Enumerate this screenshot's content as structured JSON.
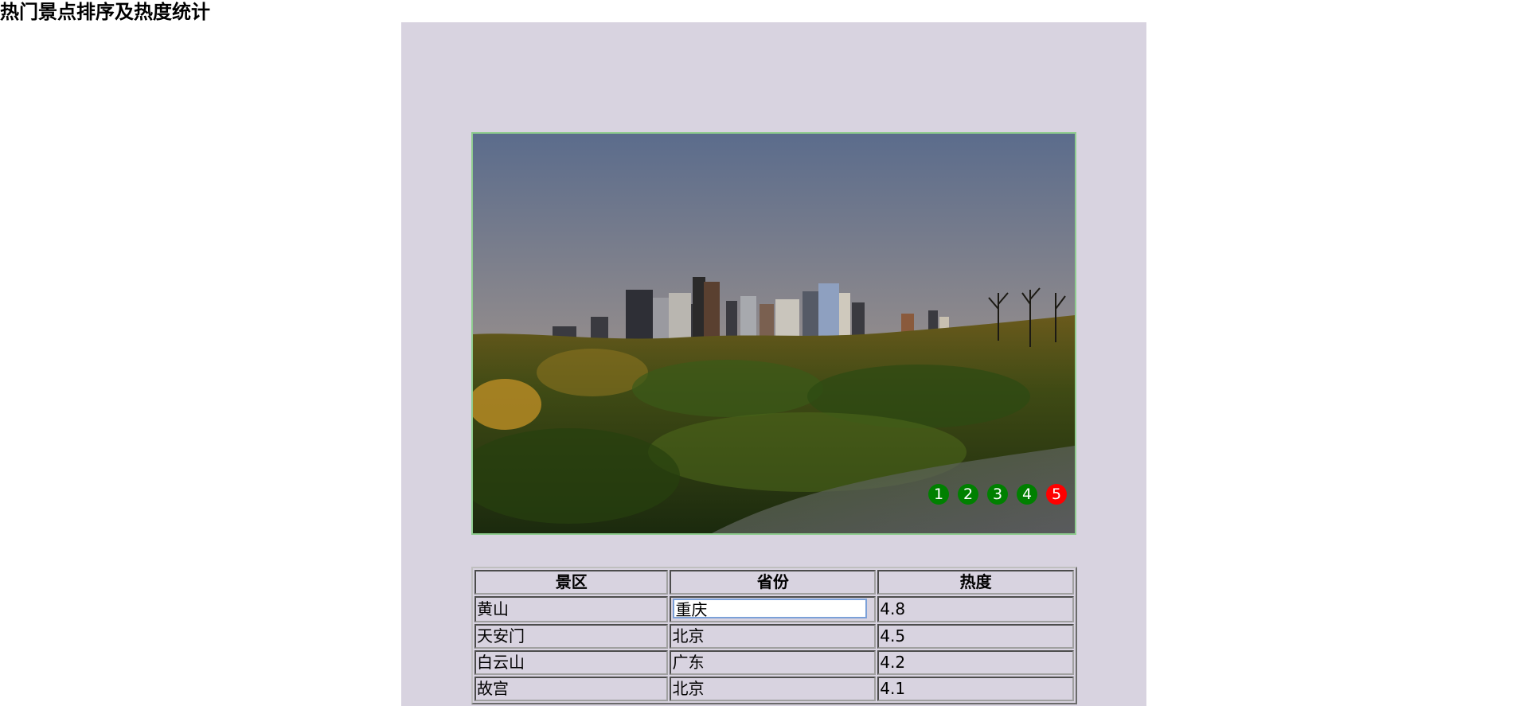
{
  "page": {
    "title": "热门景点排序及热度统计"
  },
  "carousel": {
    "dots": [
      "1",
      "2",
      "3",
      "4",
      "5"
    ],
    "active_index": 5,
    "colors": {
      "dot": "#008000",
      "dot_active": "#ff0000"
    }
  },
  "table": {
    "headers": [
      "景区",
      "省份",
      "热度"
    ],
    "rows": [
      {
        "name": "黄山",
        "province": "重庆",
        "heat": "4.8"
      },
      {
        "name": "天安门",
        "province": "北京",
        "heat": "4.5"
      },
      {
        "name": "白云山",
        "province": "广东",
        "heat": "4.2"
      },
      {
        "name": "故宫",
        "province": "北京",
        "heat": "4.1"
      }
    ]
  },
  "colors": {
    "panel_background": "#d8d3e0",
    "carousel_border": "#8fcc8f"
  }
}
